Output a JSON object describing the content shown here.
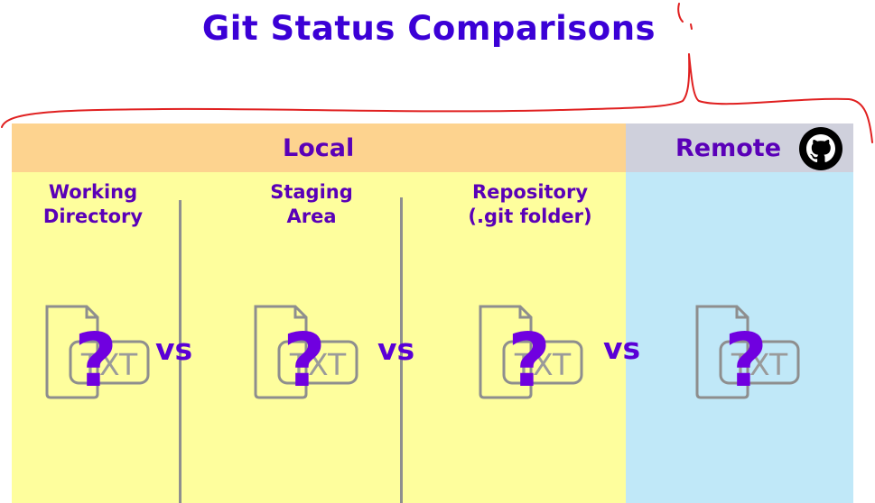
{
  "title": "Git Status Comparisons",
  "sections": {
    "local": "Local",
    "remote": "Remote"
  },
  "areas": [
    {
      "label": "Working\nDirectory"
    },
    {
      "label": "Staging\nArea"
    },
    {
      "label": "Repository\n(.git folder)"
    }
  ],
  "icons": {
    "file": "txt-file-icon",
    "unknown": "question-mark",
    "remote_logo": "github-icon"
  },
  "file_icon": {
    "ext": "TXT",
    "question": "?"
  },
  "vs": "vs",
  "colors": {
    "title": "#3b00d6",
    "local_header": "#fdd38f",
    "remote_header": "#cfd0dc",
    "local_panel": "#fefe9d",
    "remote_panel": "#c0e8f8",
    "annotation": "#e02020"
  }
}
